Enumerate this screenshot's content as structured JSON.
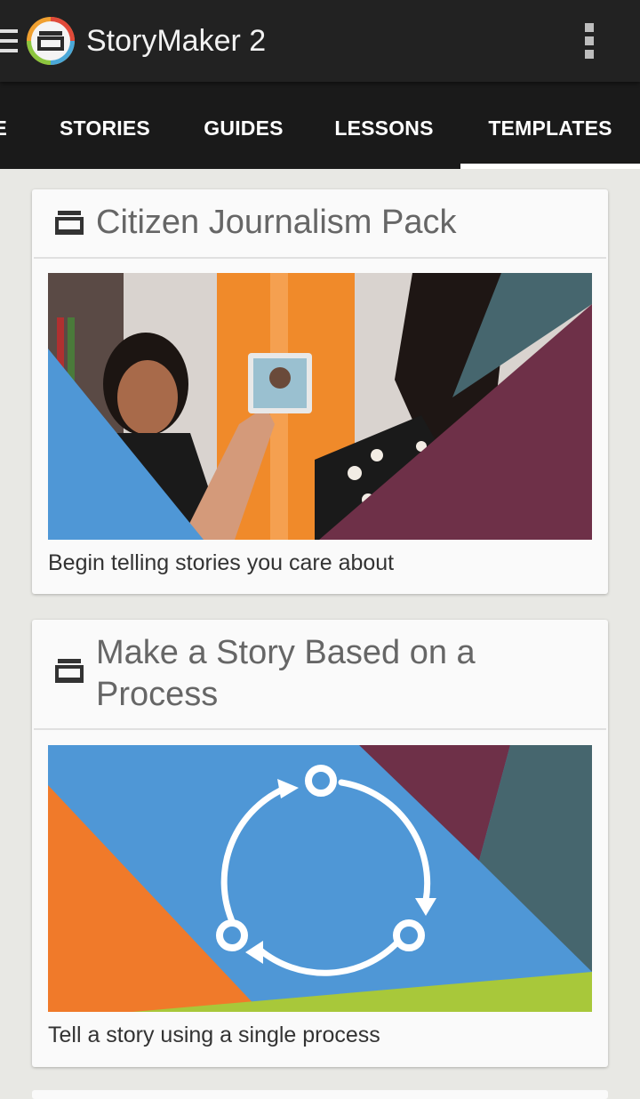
{
  "app": {
    "title": "StoryMaker 2",
    "icons": {
      "menu": "hamburger-menu-icon",
      "logo": "storymaker-logo-icon",
      "overflow": "overflow-menu-icon"
    }
  },
  "tabs": {
    "items": [
      {
        "label": "E"
      },
      {
        "label": "STORIES"
      },
      {
        "label": "GUIDES"
      },
      {
        "label": "LESSONS"
      },
      {
        "label": "TEMPLATES"
      }
    ],
    "selected": "TEMPLATES"
  },
  "cards": [
    {
      "icon": "archive-box-icon",
      "title": "Citizen Journalism Pack",
      "description": "Begin telling stories you care about"
    },
    {
      "icon": "archive-box-icon",
      "title": "Make a Story Based on a Process",
      "description": "Tell a story using a single process"
    }
  ],
  "colors": {
    "appbar": "#222222",
    "tabbar": "#1a1a1a",
    "background": "#e8e8e4",
    "card": "#fafafa",
    "accent_blue": "#4f97d6",
    "accent_orange": "#f07a2a",
    "accent_maroon": "#6e3048",
    "accent_teal": "#46666e",
    "accent_green": "#a8c83a"
  }
}
